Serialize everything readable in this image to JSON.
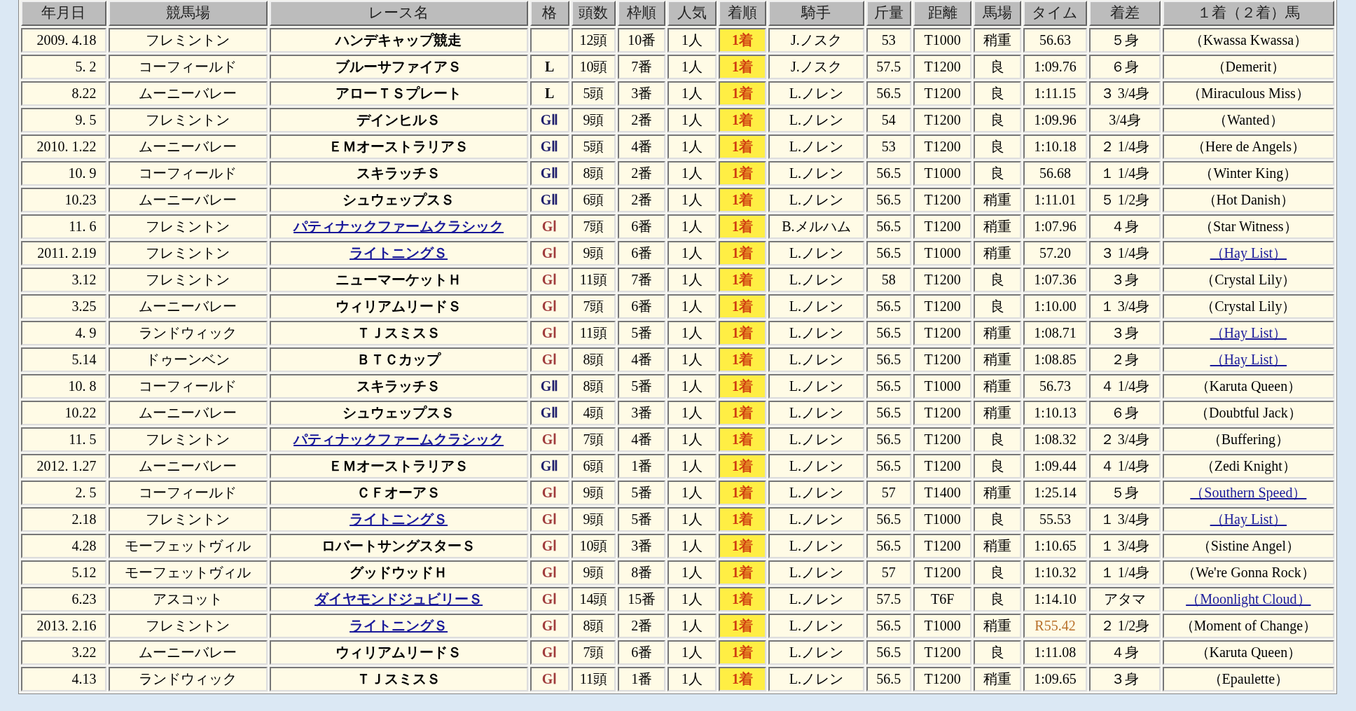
{
  "table": {
    "columns": [
      "年月日",
      "競馬場",
      "レース名",
      "格",
      "頭数",
      "枠順",
      "人気",
      "着順",
      "騎手",
      "斤量",
      "距離",
      "馬場",
      "タイム",
      "着差",
      "１着（２着）馬"
    ],
    "rows": [
      {
        "date": "2009. 4.18",
        "course": "フレミントン",
        "race": "ハンデキャップ競走",
        "race_link": false,
        "kind": "none",
        "runners": "12頭",
        "gate": "10番",
        "odds_rank": "1人",
        "place": "1着",
        "jockey": "J.ノスク",
        "weight": "53",
        "distance": "T1000",
        "going": "稍重",
        "time": "56.63",
        "record": false,
        "margin": "５身",
        "horse": "（Kwassa Kwassa）",
        "horse_link": false
      },
      {
        "date": "5. 2",
        "course": "コーフィールド",
        "race": "ブルーサファイアＳ",
        "race_link": false,
        "kind": "listed",
        "grade": "L",
        "runners": "10頭",
        "gate": "7番",
        "odds_rank": "1人",
        "place": "1着",
        "jockey": "J.ノスク",
        "weight": "57.5",
        "distance": "T1200",
        "going": "良",
        "time": "1:09.76",
        "record": false,
        "margin": "６身",
        "horse": "（Demerit）",
        "horse_link": false
      },
      {
        "date": "8.22",
        "course": "ムーニーバレー",
        "race": "アローＴＳプレート",
        "race_link": false,
        "kind": "listed",
        "grade": "L",
        "runners": "5頭",
        "gate": "3番",
        "odds_rank": "1人",
        "place": "1着",
        "jockey": "L.ノレン",
        "weight": "56.5",
        "distance": "T1200",
        "going": "良",
        "time": "1:11.15",
        "record": false,
        "margin": "３ 3/4身",
        "horse": "（Miraculous Miss）",
        "horse_link": false
      },
      {
        "date": "9. 5",
        "course": "フレミントン",
        "race": "デインヒルＳ",
        "race_link": false,
        "kind": "g2",
        "grade": "GⅡ",
        "runners": "9頭",
        "gate": "2番",
        "odds_rank": "1人",
        "place": "1着",
        "jockey": "L.ノレン",
        "weight": "54",
        "distance": "T1200",
        "going": "良",
        "time": "1:09.96",
        "record": false,
        "margin": "3/4身",
        "horse": "（Wanted）",
        "horse_link": false
      },
      {
        "date": "2010. 1.22",
        "course": "ムーニーバレー",
        "race": "ＥＭオーストラリアＳ",
        "race_link": false,
        "kind": "g2",
        "grade": "GⅡ",
        "runners": "5頭",
        "gate": "4番",
        "odds_rank": "1人",
        "place": "1着",
        "jockey": "L.ノレン",
        "weight": "53",
        "distance": "T1200",
        "going": "良",
        "time": "1:10.18",
        "record": false,
        "margin": "２ 1/4身",
        "horse": "（Here de Angels）",
        "horse_link": false
      },
      {
        "date": "10. 9",
        "course": "コーフィールド",
        "race": "スキラッチＳ",
        "race_link": false,
        "kind": "g2",
        "grade": "GⅡ",
        "runners": "8頭",
        "gate": "2番",
        "odds_rank": "1人",
        "place": "1着",
        "jockey": "L.ノレン",
        "weight": "56.5",
        "distance": "T1000",
        "going": "良",
        "time": "56.68",
        "record": false,
        "margin": "１ 1/4身",
        "horse": "（Winter King）",
        "horse_link": false
      },
      {
        "date": "10.23",
        "course": "ムーニーバレー",
        "race": "シュウェップスＳ",
        "race_link": false,
        "kind": "g2",
        "grade": "GⅡ",
        "runners": "6頭",
        "gate": "2番",
        "odds_rank": "1人",
        "place": "1着",
        "jockey": "L.ノレン",
        "weight": "56.5",
        "distance": "T1200",
        "going": "稍重",
        "time": "1:11.01",
        "record": false,
        "margin": "５ 1/2身",
        "horse": "（Hot Danish）",
        "horse_link": false
      },
      {
        "date": "11. 6",
        "course": "フレミントン",
        "race": "パティナックファームクラシック",
        "race_link": true,
        "kind": "g1",
        "grade": "GⅠ",
        "runners": "7頭",
        "gate": "6番",
        "odds_rank": "1人",
        "place": "1着",
        "jockey": "B.メルハム",
        "weight": "56.5",
        "distance": "T1200",
        "going": "稍重",
        "time": "1:07.96",
        "record": false,
        "margin": "４身",
        "horse": "（Star Witness）",
        "horse_link": false
      },
      {
        "date": "2011. 2.19",
        "course": "フレミントン",
        "race": "ライトニングＳ",
        "race_link": true,
        "kind": "g1",
        "grade": "GⅠ",
        "runners": "9頭",
        "gate": "6番",
        "odds_rank": "1人",
        "place": "1着",
        "jockey": "L.ノレン",
        "weight": "56.5",
        "distance": "T1000",
        "going": "稍重",
        "time": "57.20",
        "record": false,
        "margin": "３ 1/4身",
        "horse": "（Hay List）",
        "horse_link": true
      },
      {
        "date": "3.12",
        "course": "フレミントン",
        "race": "ニューマーケットＨ",
        "race_link": false,
        "kind": "g1",
        "grade": "GⅠ",
        "runners": "11頭",
        "gate": "7番",
        "odds_rank": "1人",
        "place": "1着",
        "jockey": "L.ノレン",
        "weight": "58",
        "distance": "T1200",
        "going": "良",
        "time": "1:07.36",
        "record": false,
        "margin": "３身",
        "horse": "（Crystal Lily）",
        "horse_link": false
      },
      {
        "date": "3.25",
        "course": "ムーニーバレー",
        "race": "ウィリアムリードＳ",
        "race_link": false,
        "kind": "g1",
        "grade": "GⅠ",
        "runners": "7頭",
        "gate": "6番",
        "odds_rank": "1人",
        "place": "1着",
        "jockey": "L.ノレン",
        "weight": "56.5",
        "distance": "T1200",
        "going": "良",
        "time": "1:10.00",
        "record": false,
        "margin": "１ 3/4身",
        "horse": "（Crystal Lily）",
        "horse_link": false
      },
      {
        "date": "4. 9",
        "course": "ランドウィック",
        "race": "ＴＪスミスＳ",
        "race_link": false,
        "kind": "g1",
        "grade": "GⅠ",
        "runners": "11頭",
        "gate": "5番",
        "odds_rank": "1人",
        "place": "1着",
        "jockey": "L.ノレン",
        "weight": "56.5",
        "distance": "T1200",
        "going": "稍重",
        "time": "1:08.71",
        "record": false,
        "margin": "３身",
        "horse": "（Hay List）",
        "horse_link": true
      },
      {
        "date": "5.14",
        "course": "ドゥーンベン",
        "race": "ＢＴＣカップ",
        "race_link": false,
        "kind": "g1",
        "grade": "GⅠ",
        "runners": "8頭",
        "gate": "4番",
        "odds_rank": "1人",
        "place": "1着",
        "jockey": "L.ノレン",
        "weight": "56.5",
        "distance": "T1200",
        "going": "稍重",
        "time": "1:08.85",
        "record": false,
        "margin": "２身",
        "horse": "（Hay List）",
        "horse_link": true
      },
      {
        "date": "10. 8",
        "course": "コーフィールド",
        "race": "スキラッチＳ",
        "race_link": false,
        "kind": "g2",
        "grade": "GⅡ",
        "runners": "8頭",
        "gate": "5番",
        "odds_rank": "1人",
        "place": "1着",
        "jockey": "L.ノレン",
        "weight": "56.5",
        "distance": "T1000",
        "going": "稍重",
        "time": "56.73",
        "record": false,
        "margin": "４ 1/4身",
        "horse": "（Karuta Queen）",
        "horse_link": false
      },
      {
        "date": "10.22",
        "course": "ムーニーバレー",
        "race": "シュウェップスＳ",
        "race_link": false,
        "kind": "g2",
        "grade": "GⅡ",
        "runners": "4頭",
        "gate": "3番",
        "odds_rank": "1人",
        "place": "1着",
        "jockey": "L.ノレン",
        "weight": "56.5",
        "distance": "T1200",
        "going": "稍重",
        "time": "1:10.13",
        "record": false,
        "margin": "６身",
        "horse": "（Doubtful Jack）",
        "horse_link": false
      },
      {
        "date": "11. 5",
        "course": "フレミントン",
        "race": "パティナックファームクラシック",
        "race_link": true,
        "kind": "g1",
        "grade": "GⅠ",
        "runners": "7頭",
        "gate": "4番",
        "odds_rank": "1人",
        "place": "1着",
        "jockey": "L.ノレン",
        "weight": "56.5",
        "distance": "T1200",
        "going": "良",
        "time": "1:08.32",
        "record": false,
        "margin": "２ 3/4身",
        "horse": "（Buffering）",
        "horse_link": false
      },
      {
        "date": "2012. 1.27",
        "course": "ムーニーバレー",
        "race": "ＥＭオーストラリアＳ",
        "race_link": false,
        "kind": "g2",
        "grade": "GⅡ",
        "runners": "6頭",
        "gate": "1番",
        "odds_rank": "1人",
        "place": "1着",
        "jockey": "L.ノレン",
        "weight": "56.5",
        "distance": "T1200",
        "going": "良",
        "time": "1:09.44",
        "record": false,
        "margin": "４ 1/4身",
        "horse": "（Zedi Knight）",
        "horse_link": false
      },
      {
        "date": "2. 5",
        "course": "コーフィールド",
        "race": "ＣＦオーアＳ",
        "race_link": false,
        "kind": "g1",
        "grade": "GⅠ",
        "runners": "9頭",
        "gate": "5番",
        "odds_rank": "1人",
        "place": "1着",
        "jockey": "L.ノレン",
        "weight": "57",
        "distance": "T1400",
        "going": "稍重",
        "time": "1:25.14",
        "record": false,
        "margin": "５身",
        "horse": "（Southern Speed）",
        "horse_link": true
      },
      {
        "date": "2.18",
        "course": "フレミントン",
        "race": "ライトニングＳ",
        "race_link": true,
        "kind": "g1",
        "grade": "GⅠ",
        "runners": "9頭",
        "gate": "5番",
        "odds_rank": "1人",
        "place": "1着",
        "jockey": "L.ノレン",
        "weight": "56.5",
        "distance": "T1000",
        "going": "良",
        "time": "55.53",
        "record": false,
        "margin": "１ 3/4身",
        "horse": "（Hay List）",
        "horse_link": true
      },
      {
        "date": "4.28",
        "course": "モーフェットヴィル",
        "race": "ロバートサングスターＳ",
        "race_link": false,
        "kind": "g1",
        "grade": "GⅠ",
        "runners": "10頭",
        "gate": "3番",
        "odds_rank": "1人",
        "place": "1着",
        "jockey": "L.ノレン",
        "weight": "56.5",
        "distance": "T1200",
        "going": "稍重",
        "time": "1:10.65",
        "record": false,
        "margin": "１ 3/4身",
        "horse": "（Sistine Angel）",
        "horse_link": false
      },
      {
        "date": "5.12",
        "course": "モーフェットヴィル",
        "race": "グッドウッドＨ",
        "race_link": false,
        "kind": "g1",
        "grade": "GⅠ",
        "runners": "9頭",
        "gate": "8番",
        "odds_rank": "1人",
        "place": "1着",
        "jockey": "L.ノレン",
        "weight": "57",
        "distance": "T1200",
        "going": "良",
        "time": "1:10.32",
        "record": false,
        "margin": "１ 1/4身",
        "horse": "（We're Gonna Rock）",
        "horse_link": false
      },
      {
        "date": "6.23",
        "course": "アスコット",
        "race": "ダイヤモンドジュビリーＳ",
        "race_link": true,
        "kind": "g1",
        "grade": "GⅠ",
        "runners": "14頭",
        "gate": "15番",
        "odds_rank": "1人",
        "place": "1着",
        "jockey": "L.ノレン",
        "weight": "57.5",
        "distance": "T6F",
        "going": "良",
        "time": "1:14.10",
        "record": false,
        "margin": "アタマ",
        "horse": "（Moonlight Cloud）",
        "horse_link": true
      },
      {
        "date": "2013. 2.16",
        "course": "フレミントン",
        "race": "ライトニングＳ",
        "race_link": true,
        "kind": "g1",
        "grade": "GⅠ",
        "runners": "8頭",
        "gate": "2番",
        "odds_rank": "1人",
        "place": "1着",
        "jockey": "L.ノレン",
        "weight": "56.5",
        "distance": "T1000",
        "going": "稍重",
        "time": "R55.42",
        "record": true,
        "margin": "２ 1/2身",
        "horse": "（Moment of Change）",
        "horse_link": false
      },
      {
        "date": "3.22",
        "course": "ムーニーバレー",
        "race": "ウィリアムリードＳ",
        "race_link": false,
        "kind": "g1",
        "grade": "GⅠ",
        "runners": "7頭",
        "gate": "6番",
        "odds_rank": "1人",
        "place": "1着",
        "jockey": "L.ノレン",
        "weight": "56.5",
        "distance": "T1200",
        "going": "良",
        "time": "1:11.08",
        "record": false,
        "margin": "４身",
        "horse": "（Karuta Queen）",
        "horse_link": false
      },
      {
        "date": "4.13",
        "course": "ランドウィック",
        "race": "ＴＪスミスＳ",
        "race_link": false,
        "kind": "g1",
        "grade": "GⅠ",
        "runners": "11頭",
        "gate": "1番",
        "odds_rank": "1人",
        "place": "1着",
        "jockey": "L.ノレン",
        "weight": "56.5",
        "distance": "T1200",
        "going": "稍重",
        "time": "1:09.65",
        "record": false,
        "margin": "３身",
        "horse": "（Epaulette）",
        "horse_link": false
      }
    ]
  }
}
